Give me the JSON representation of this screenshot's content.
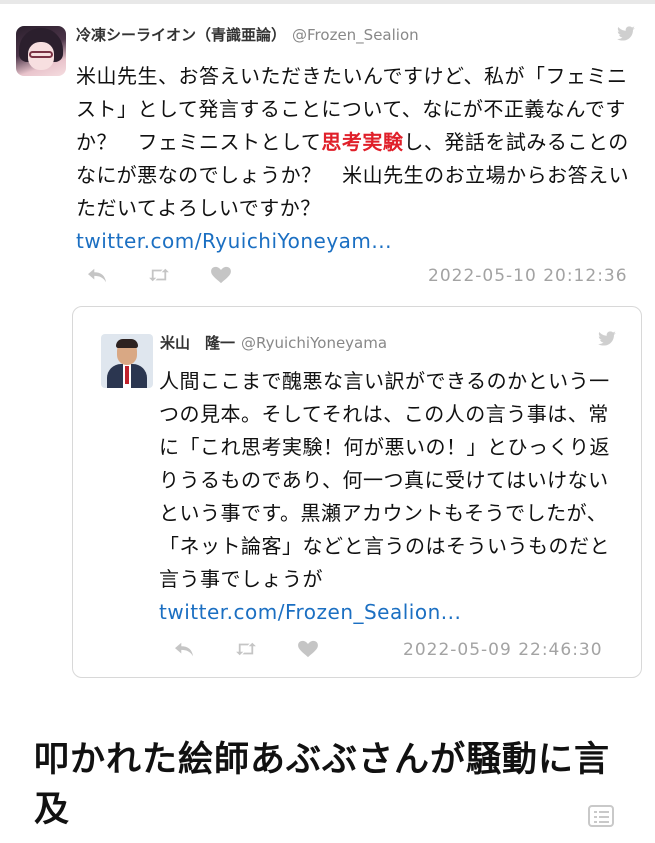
{
  "main_tweet": {
    "display_name": "冷凍シーライオン（青識亜論）",
    "handle": "@Frozen_Sealion",
    "text_before": "米山先生、お答えいただきたいんですけど、私が「フェミニスト」として発言することについて、なにが不正義なんですか？　フェミニストとして",
    "text_highlight": "思考実験",
    "text_after": "し、発話を試みることのなにが悪なのでしょうか？　米山先生のお立場からお答えいただいてよろしいですか？",
    "link": "twitter.com/RyuichiYoneyam...",
    "timestamp": "2022-05-10 20:12:36",
    "icons": [
      "reply-icon",
      "retweet-icon",
      "like-icon",
      "twitter-bird-icon"
    ]
  },
  "quoted_tweet": {
    "display_name": "米山　隆一",
    "handle": "@RyuichiYoneyama",
    "text": "人間ここまで醜悪な言い訳ができるのかという一つの見本。そしてそれは、この人の言う事は、常に「これ思考実験！何が悪いの！」とひっくり返りうるものであり、何一つ真に受けてはいけないという事です。黒瀬アカウントもそうでしたが、「ネット論客」などと言うのはそういうものだと言う事でしょうが",
    "link": "twitter.com/Frozen_Sealion...",
    "timestamp": "2022-05-09 22:46:30"
  },
  "article": {
    "headline": "叩かれた絵師あぶぶさんが騒動に言及"
  },
  "colors": {
    "highlight": "#e0202a",
    "link": "#1b6fc2",
    "muted": "#a3a3a3",
    "icon_gray": "#c5c5c5",
    "bird_gray": "#cfcfcf"
  }
}
